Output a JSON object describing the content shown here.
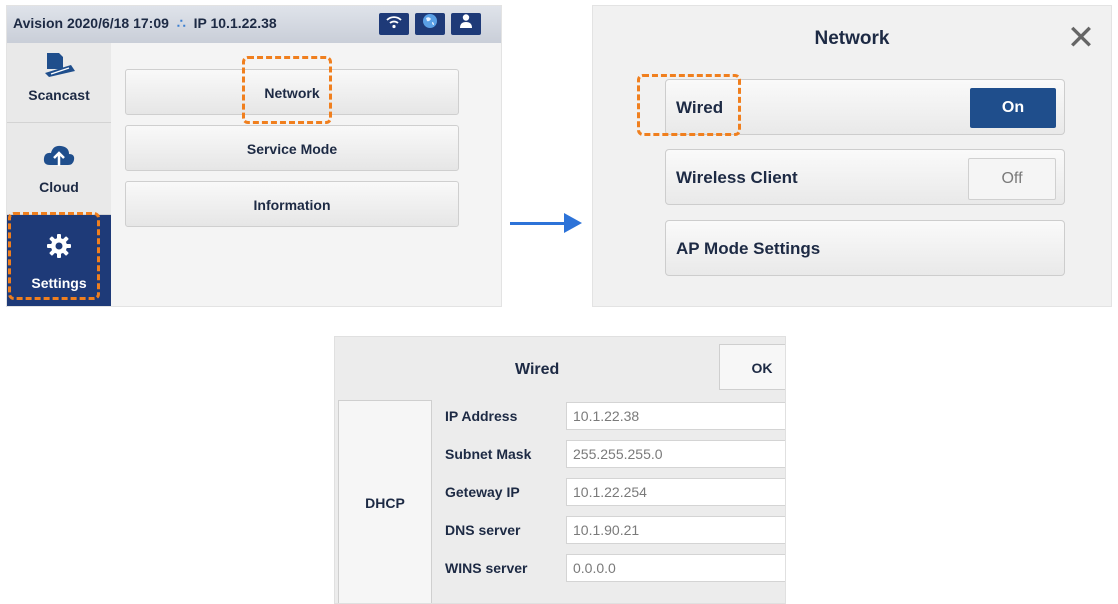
{
  "panel1": {
    "status": {
      "brand": "Avision",
      "datetime": "2020/6/18 17:09",
      "ip": "IP 10.1.22.38",
      "icons": [
        "wifi-icon",
        "globe-icon",
        "user-icon"
      ]
    },
    "sidebar": {
      "items": [
        {
          "label": "Scancast",
          "icon": "scancast-icon"
        },
        {
          "label": "Cloud",
          "icon": "cloud-upload-icon"
        },
        {
          "label": "Settings",
          "icon": "gear-icon",
          "selected": true
        }
      ]
    },
    "menu": [
      "Network",
      "Service Mode",
      "Information"
    ]
  },
  "panel2": {
    "title": "Network",
    "rows": [
      {
        "label": "Wired",
        "toggle": "On"
      },
      {
        "label": "Wireless Client",
        "toggle": "Off"
      },
      {
        "label": "AP Mode Settings"
      }
    ]
  },
  "panel3": {
    "title": "Wired",
    "ok_label": "OK",
    "dhcp_label": "DHCP",
    "fields": [
      {
        "label": "IP Address",
        "value": "10.1.22.38"
      },
      {
        "label": "Subnet Mask",
        "value": "255.255.255.0"
      },
      {
        "label": "Geteway IP",
        "value": "10.1.22.254"
      },
      {
        "label": "DNS server",
        "value": "10.1.90.21"
      },
      {
        "label": "WINS server",
        "value": "0.0.0.0"
      }
    ]
  },
  "colors": {
    "accent_navy": "#1f4e8c",
    "highlight_orange": "#f07f1e",
    "arrow_blue": "#2d73d8",
    "sidebar_selected": "#1e3a78"
  }
}
